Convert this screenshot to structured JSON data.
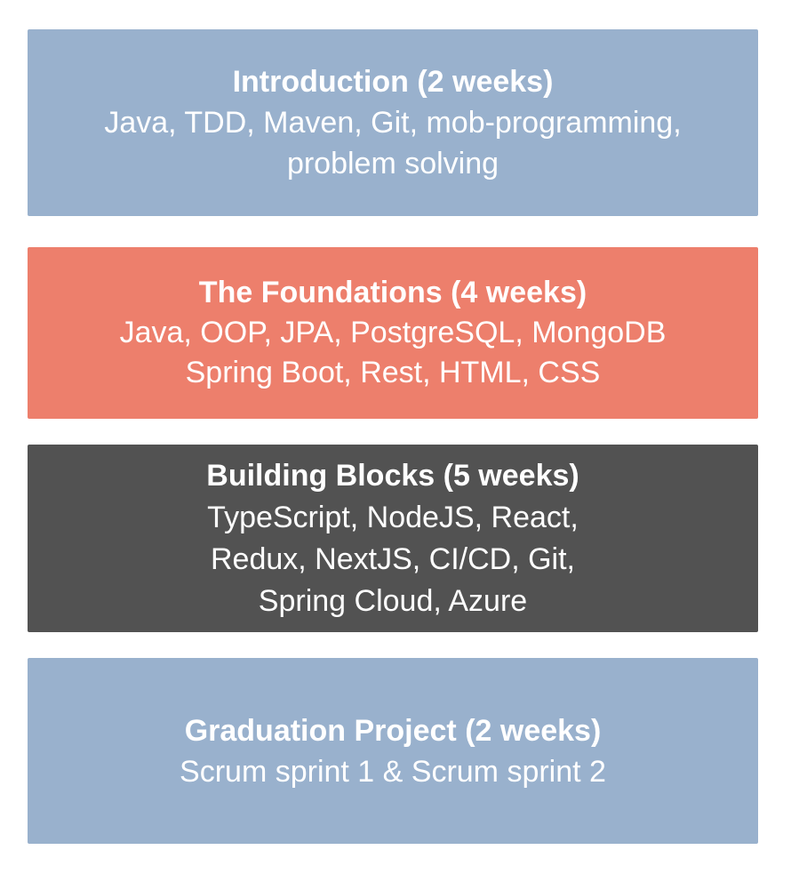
{
  "blocks": [
    {
      "title": "Introduction (2 weeks)",
      "lines": [
        "Java, TDD, Maven, Git, mob-programming,",
        "problem solving"
      ],
      "color": "#99b1cd"
    },
    {
      "title": "The Foundations (4 weeks)",
      "lines": [
        "Java, OOP, JPA, PostgreSQL, MongoDB",
        "Spring Boot, Rest, HTML, CSS"
      ],
      "color": "#ed7f6c"
    },
    {
      "title": "Building Blocks (5 weeks)",
      "lines": [
        "TypeScript, NodeJS, React,",
        "Redux, NextJS, CI/CD, Git,",
        "Spring Cloud, Azure"
      ],
      "color": "#525252"
    },
    {
      "title": "Graduation Project (2 weeks)",
      "lines": [
        "Scrum sprint 1 & Scrum sprint 2"
      ],
      "color": "#99b1cd"
    }
  ]
}
